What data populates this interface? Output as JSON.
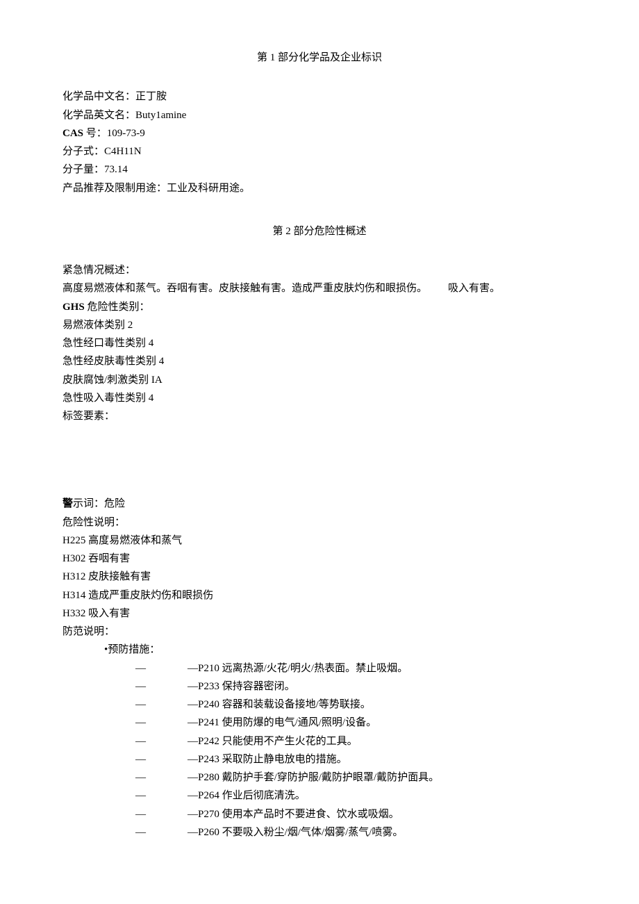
{
  "section1": {
    "title": "第 1 部分化学品及企业标识",
    "fields": {
      "name_cn_label": "化学品中文名：",
      "name_cn_value": "正丁胺",
      "name_en_label": "化学品英文名：",
      "name_en_value": "Buty1amine",
      "cas_label": "CAS",
      "cas_mid": " 号：",
      "cas_value": "109-73-9",
      "formula_label": "分子式：",
      "formula_value": "C4H11N",
      "weight_label": "分子量：",
      "weight_value": "73.14",
      "usage_label": "产品推荐及限制用途：",
      "usage_value": "工业及科研用途。"
    }
  },
  "section2": {
    "title": "第 2 部分危险性概述",
    "emergency_label": "紧急情况概述：",
    "emergency_main": "高度易燃液体和蒸气。吞咽有害。皮肤接触有害。造成严重皮肤灼伤和眼损伤。",
    "emergency_extra": "吸入有害。",
    "ghs_label_bold": "GHS",
    "ghs_label_rest": " 危险性类别：",
    "ghs_categories": [
      "易燃液体类别 2",
      "急性经口毒性类别 4",
      "急性经皮肤毒性类别 4",
      "皮肤腐蚀/刺激类别 IA",
      "急性吸入毒性类别 4"
    ],
    "label_elements": "标签要素：",
    "signal_bold": "警",
    "signal_rest": "示词：危险",
    "hazard_statements_label": "危险性说明：",
    "hazard_statements": [
      "H225 高度易燃液体和蒸气",
      "H302 吞咽有害",
      "H312 皮肤接触有害",
      "H314 造成严重皮肤灼伤和眼损伤",
      "H332 吸入有害"
    ],
    "precaution_label": "防范说明：",
    "prevention_header": "•预防措施：",
    "prevention_items": [
      "—P210 远离热源/火花/明火/热表面。禁止吸烟。",
      "—P233 保持容器密闭。",
      "—P240 容器和装载设备接地/等势联接。",
      "—P241 使用防爆的电气/通风/照明/设备。",
      "—P242 只能使用不产生火花的工具。",
      "—P243 采取防止静电放电的措施。",
      "—P280 戴防护手套/穿防护服/戴防护眼罩/戴防护面具。",
      "—P264 作业后彻底清洗。",
      "—P270 使用本产品时不要进食、饮水或吸烟。",
      "—P260 不要吸入粉尘/烟/气体/烟雾/蒸气/喷雾。"
    ]
  }
}
